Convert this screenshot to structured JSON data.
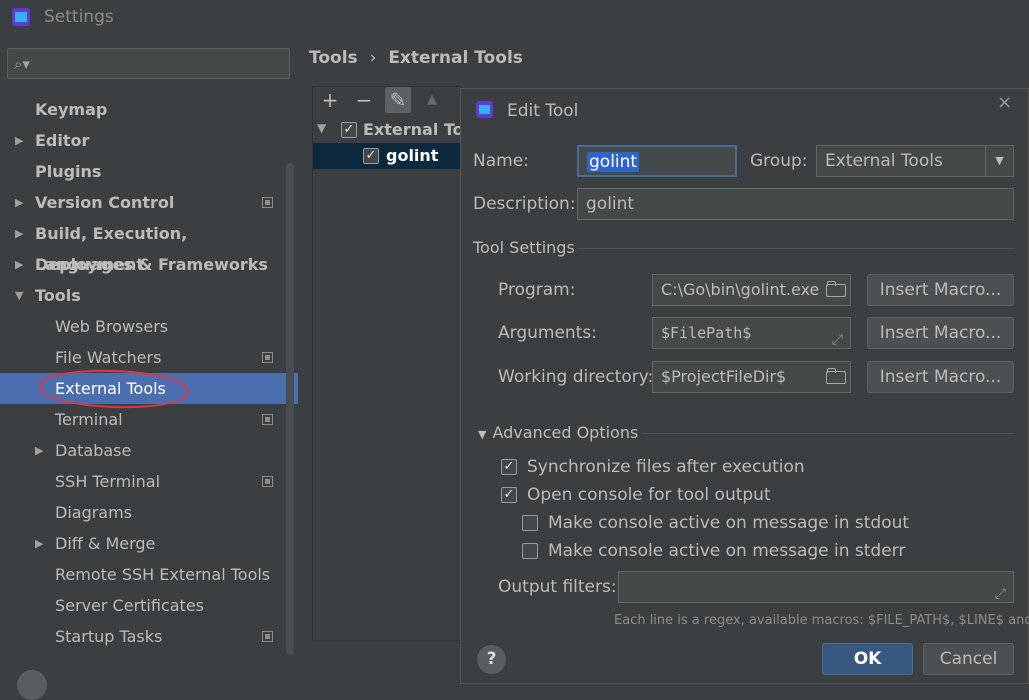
{
  "window": {
    "title": "Settings"
  },
  "search": {
    "placeholder": ""
  },
  "sidebar": {
    "items": [
      {
        "label": "Keymap",
        "bold": true
      },
      {
        "label": "Editor",
        "bold": true,
        "arrow": "▶"
      },
      {
        "label": "Plugins",
        "bold": true
      },
      {
        "label": "Version Control",
        "bold": true,
        "arrow": "▶",
        "project": true
      },
      {
        "label": "Build, Execution, Deployment",
        "bold": true,
        "arrow": "▶"
      },
      {
        "label": "Languages & Frameworks",
        "bold": true,
        "arrow": "▶"
      },
      {
        "label": "Tools",
        "bold": true,
        "arrow": "▼"
      },
      {
        "label": "Web Browsers"
      },
      {
        "label": "File Watchers",
        "project": true
      },
      {
        "label": "External Tools",
        "selected": true
      },
      {
        "label": "Terminal",
        "project": true
      },
      {
        "label": "Database",
        "arrow": "▶"
      },
      {
        "label": "SSH Terminal",
        "project": true
      },
      {
        "label": "Diagrams"
      },
      {
        "label": "Diff & Merge",
        "arrow": "▶"
      },
      {
        "label": "Remote SSH External Tools"
      },
      {
        "label": "Server Certificates"
      },
      {
        "label": "Startup Tasks",
        "project": true
      }
    ]
  },
  "breadcrumb": {
    "parent": "Tools",
    "separator": "›",
    "current": "External Tools"
  },
  "tool_panel": {
    "toolbar": {
      "add": "+",
      "remove": "−",
      "edit": "✎",
      "up": "▲"
    },
    "tree": [
      {
        "label": "External Tools",
        "checked": true,
        "arrow": "▼"
      },
      {
        "label": "golint",
        "checked": true,
        "selected": true
      }
    ]
  },
  "dialog": {
    "title": "Edit Tool",
    "close": "×",
    "name_label": "Name:",
    "name_value": "golint",
    "group_label": "Group:",
    "group_value": "External Tools",
    "description_label": "Description:",
    "description_value": "golint",
    "tool_settings_label": "Tool Settings",
    "program_label": "Program:",
    "program_value": "C:\\Go\\bin\\golint.exe",
    "arguments_label": "Arguments:",
    "arguments_value": "$FilePath$",
    "workdir_label": "Working directory:",
    "workdir_value": "$ProjectFileDir$",
    "insert_macro": "Insert Macro...",
    "advanced_label": "Advanced Options",
    "sync_label": "Synchronize files after execution",
    "console_label": "Open console for tool output",
    "stdout_label": "Make console active on message in stdout",
    "stderr_label": "Make console active on message in stderr",
    "output_filters_label": "Output filters:",
    "output_filters_value": "",
    "hint": "Each line is a regex, available macros: $FILE_PATH$, $LINE$ and...",
    "ok": "OK",
    "cancel": "Cancel",
    "help": "?"
  },
  "colors": {
    "background": "#3c3f41",
    "selection": "#4b6eaf",
    "ok_button": "#365880",
    "annotation": "#e8323c"
  }
}
